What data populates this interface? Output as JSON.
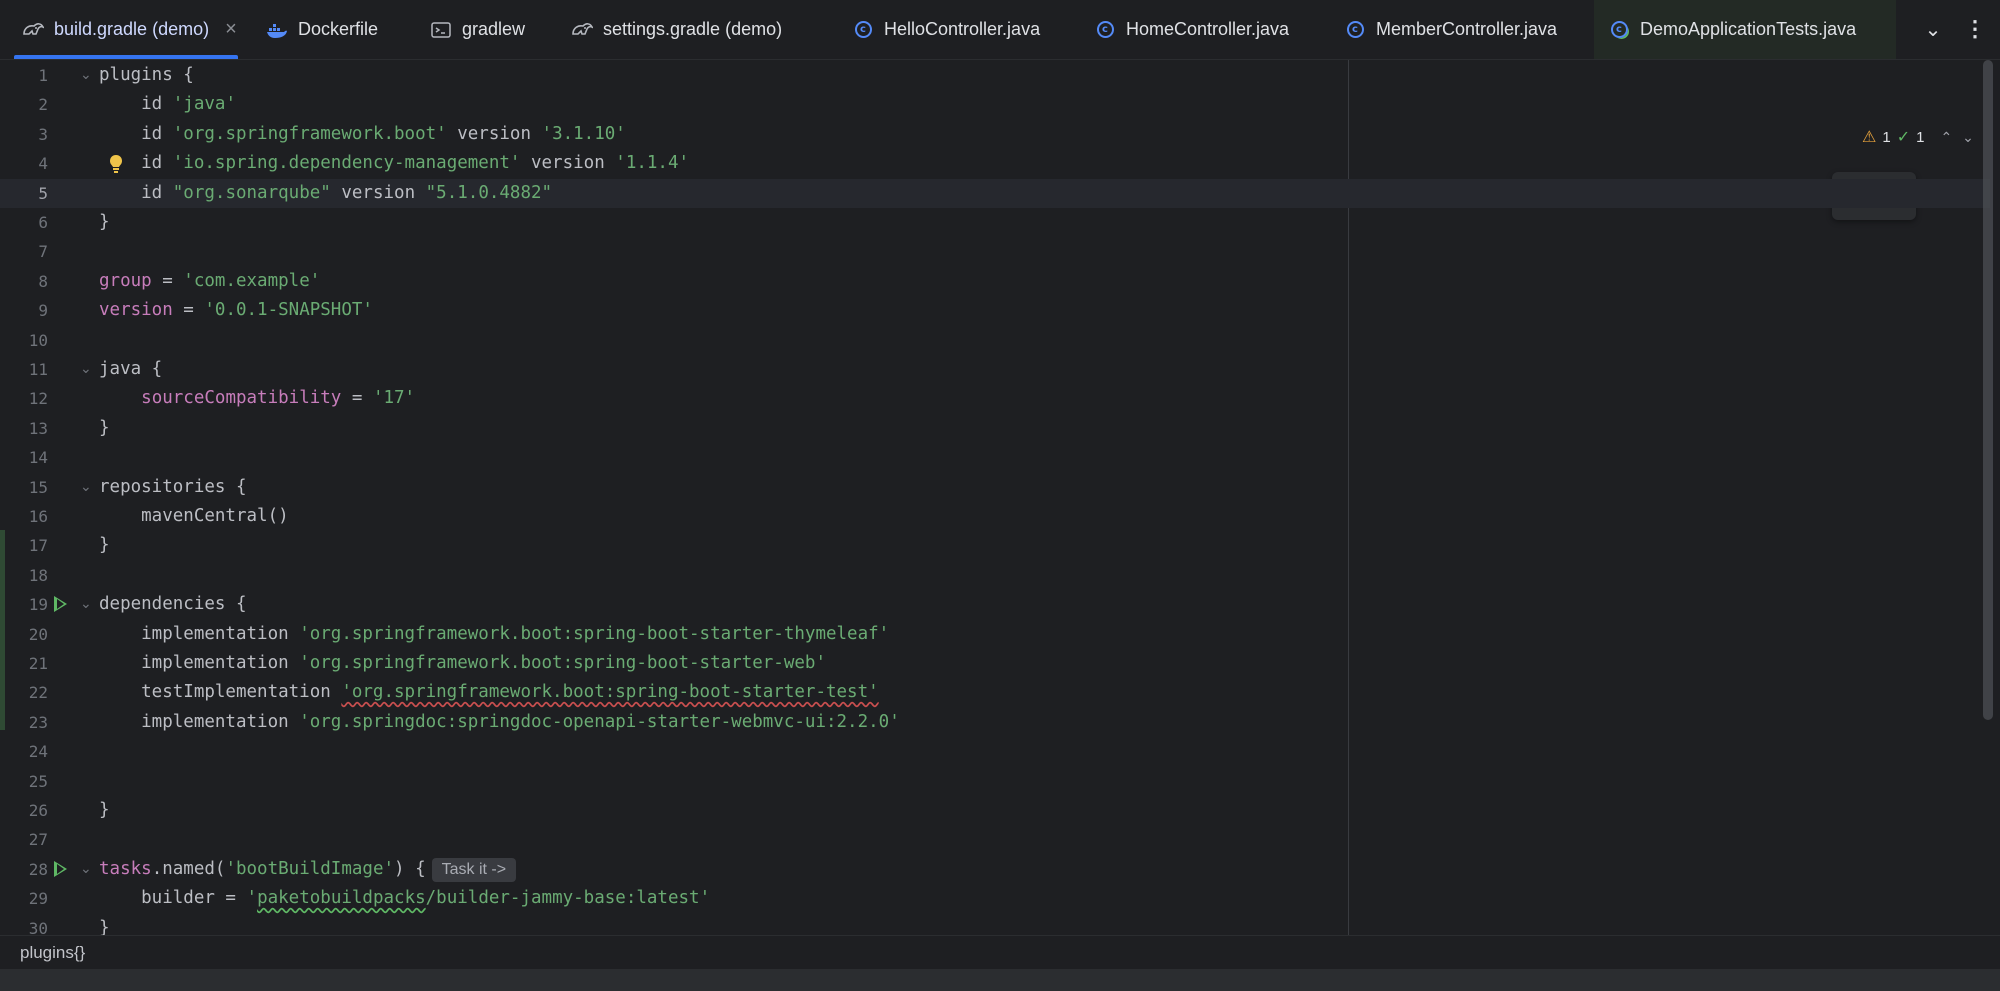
{
  "tabs": [
    {
      "label": "build.gradle (demo)",
      "icon": "gradle-icon",
      "active": true,
      "closable": true
    },
    {
      "label": "Dockerfile",
      "icon": "docker-icon"
    },
    {
      "label": "gradlew",
      "icon": "terminal-icon"
    },
    {
      "label": "settings.gradle (demo)",
      "icon": "gradle-icon"
    },
    {
      "label": "HelloController.java",
      "icon": "java-class-icon"
    },
    {
      "label": "HomeController.java",
      "icon": "java-class-icon"
    },
    {
      "label": "MemberController.java",
      "icon": "java-class-icon"
    },
    {
      "label": "DemoApplicationTests.java",
      "icon": "java-test-class-icon"
    }
  ],
  "tab_close_glyph": "×",
  "tabbar_buttons": {
    "more_tabs": "⌄",
    "menu": "⋮"
  },
  "inspections": {
    "warnings": "1",
    "ok": "1",
    "warn_glyph": "⚠",
    "ok_glyph": "✓",
    "chevron_up": "⌃",
    "chevron_down": "⌄"
  },
  "floating_toolbar": {
    "icon": "gradle-sync-icon",
    "close": "×"
  },
  "code_lines": [
    {
      "n": "1",
      "fold": true,
      "segs": [
        {
          "t": "plugins {"
        }
      ]
    },
    {
      "n": "2",
      "segs": [
        {
          "t": "    id "
        },
        {
          "t": "'java'",
          "c": "str"
        }
      ]
    },
    {
      "n": "3",
      "segs": [
        {
          "t": "    id "
        },
        {
          "t": "'org.springframework.boot'",
          "c": "str"
        },
        {
          "t": " version "
        },
        {
          "t": "'3.1.10'",
          "c": "str"
        }
      ]
    },
    {
      "n": "4",
      "bulb": true,
      "segs": [
        {
          "t": "    id "
        },
        {
          "t": "'io.spring.dependency-management'",
          "c": "str"
        },
        {
          "t": " version "
        },
        {
          "t": "'1.1.4'",
          "c": "str"
        }
      ]
    },
    {
      "n": "5",
      "current": true,
      "segs": [
        {
          "t": "    id "
        },
        {
          "t": "\"org.sonarqube\"",
          "c": "str"
        },
        {
          "t": " version "
        },
        {
          "t": "\"5.1.0.4882\"",
          "c": "str"
        }
      ]
    },
    {
      "n": "6",
      "segs": [
        {
          "t": "}"
        }
      ]
    },
    {
      "n": "7",
      "segs": []
    },
    {
      "n": "8",
      "segs": [
        {
          "t": "group",
          "c": "prop"
        },
        {
          "t": " = "
        },
        {
          "t": "'com.example'",
          "c": "str"
        }
      ]
    },
    {
      "n": "9",
      "segs": [
        {
          "t": "version",
          "c": "prop"
        },
        {
          "t": " = "
        },
        {
          "t": "'0.0.1-SNAPSHOT'",
          "c": "str"
        }
      ]
    },
    {
      "n": "10",
      "segs": []
    },
    {
      "n": "11",
      "fold": true,
      "segs": [
        {
          "t": "java {"
        }
      ]
    },
    {
      "n": "12",
      "segs": [
        {
          "t": "    "
        },
        {
          "t": "sourceCompatibility",
          "c": "prop"
        },
        {
          "t": " = "
        },
        {
          "t": "'17'",
          "c": "str"
        }
      ]
    },
    {
      "n": "13",
      "segs": [
        {
          "t": "}"
        }
      ]
    },
    {
      "n": "14",
      "segs": []
    },
    {
      "n": "15",
      "fold": true,
      "segs": [
        {
          "t": "repositories {"
        }
      ]
    },
    {
      "n": "16",
      "segs": [
        {
          "t": "    mavenCentral()"
        }
      ]
    },
    {
      "n": "17",
      "segs": [
        {
          "t": "}"
        }
      ]
    },
    {
      "n": "18",
      "segs": []
    },
    {
      "n": "19",
      "fold": true,
      "run": true,
      "segs": [
        {
          "t": "dependencies {"
        }
      ]
    },
    {
      "n": "20",
      "segs": [
        {
          "t": "    implementation "
        },
        {
          "t": "'org.springframework.boot:spring-boot-starter-thymeleaf'",
          "c": "str"
        }
      ]
    },
    {
      "n": "21",
      "segs": [
        {
          "t": "    implementation "
        },
        {
          "t": "'org.springframework.boot:spring-boot-starter-web'",
          "c": "str"
        }
      ]
    },
    {
      "n": "22",
      "segs": [
        {
          "t": "    testImplementation "
        },
        {
          "t": "'org.springframework.boot:spring-boot-starter-test'",
          "c": "str squig"
        }
      ]
    },
    {
      "n": "23",
      "segs": [
        {
          "t": "    implementation "
        },
        {
          "t": "'org.springdoc:springdoc-openapi-starter-webmvc-ui:2.2.0'",
          "c": "str"
        }
      ]
    },
    {
      "n": "24",
      "segs": []
    },
    {
      "n": "25",
      "segs": []
    },
    {
      "n": "26",
      "segs": [
        {
          "t": "}"
        }
      ]
    },
    {
      "n": "27",
      "segs": []
    },
    {
      "n": "28",
      "fold": true,
      "run": true,
      "segs": [
        {
          "t": "tasks",
          "c": "prop"
        },
        {
          "t": ".named("
        },
        {
          "t": "'bootBuildImage'",
          "c": "str"
        },
        {
          "t": ") {"
        }
      ],
      "inlay": "Task it ->"
    },
    {
      "n": "29",
      "segs": [
        {
          "t": "    builder = "
        },
        {
          "t": "'",
          "c": "str"
        },
        {
          "t": "paketobuildpacks",
          "c": "str squig-g"
        },
        {
          "t": "/builder-jammy-base:latest'",
          "c": "str"
        }
      ]
    },
    {
      "n": "30",
      "segs": [
        {
          "t": "}"
        }
      ]
    }
  ],
  "breadcrumb": "plugins{}"
}
